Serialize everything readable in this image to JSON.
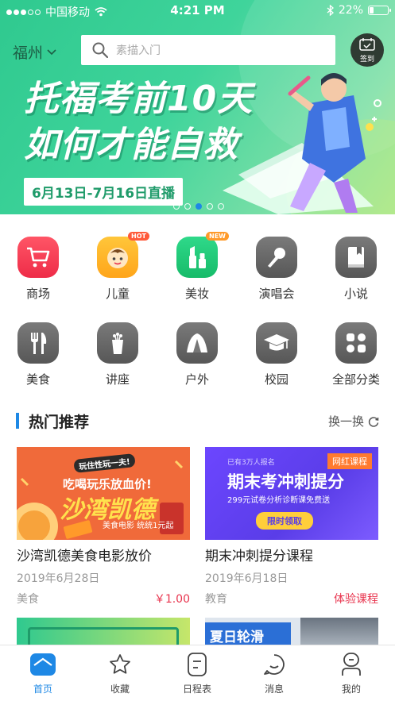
{
  "status_bar": {
    "carrier": "中国移动",
    "time": "4:21 PM",
    "battery": "22%",
    "battery_level": 0.22
  },
  "header": {
    "city": "福州",
    "search_placeholder": "素描入门",
    "checkin_label": "签到"
  },
  "banner": {
    "line1": "托福考前10天",
    "line2": "如何才能自救",
    "date_range": "6月13日-7月16日直播",
    "page_count": 5,
    "active_index": 2,
    "colors": {
      "bg_start": "#2fc98f",
      "bg_end": "#b3e88e"
    }
  },
  "categories": [
    {
      "label": "商场",
      "icon": "shopping-cart-icon",
      "color": "#f23a52"
    },
    {
      "label": "儿童",
      "icon": "child-face-icon",
      "color": "#ffb41f",
      "badge": "HOT"
    },
    {
      "label": "美妆",
      "icon": "lipstick-icon",
      "color": "#22c977",
      "badge": "NEW"
    },
    {
      "label": "演唱会",
      "icon": "microphone-icon",
      "color": "#666666"
    },
    {
      "label": "小说",
      "icon": "book-icon",
      "color": "#666666"
    },
    {
      "label": "美食",
      "icon": "fork-knife-icon",
      "color": "#666666"
    },
    {
      "label": "讲座",
      "icon": "lecture-icon",
      "color": "#666666"
    },
    {
      "label": "户外",
      "icon": "tent-icon",
      "color": "#666666"
    },
    {
      "label": "校园",
      "icon": "graduation-cap-icon",
      "color": "#666666"
    },
    {
      "label": "全部分类",
      "icon": "all-categories-icon",
      "color": "#666666"
    }
  ],
  "section": {
    "title": "热门推荐",
    "refresh_label": "换一换"
  },
  "cards": [
    {
      "title": "沙湾凯德美食电影放价",
      "date": "2019年6月28日",
      "category": "美食",
      "price": "￥1.00",
      "image_text": {
        "tag": "玩住性玩一夫!",
        "line1": "吃喝玩乐放血价!",
        "line2": "沙湾凯德",
        "line3": "美食电影 统统1元起"
      }
    },
    {
      "title": "期末冲刺提分课程",
      "date": "2019年6月18日",
      "category": "教育",
      "price": "体验课程",
      "image_text": {
        "enrolled": "已有3万人报名",
        "tag": "网红课程",
        "headline": "期末考冲刺提分",
        "sub": "299元试卷分析诊断课免费送",
        "button": "限时领取"
      }
    }
  ],
  "peek_cards": [
    {
      "text": ""
    },
    {
      "text": "夏日轮滑"
    }
  ],
  "tabs": [
    {
      "label": "首页",
      "icon": "home-icon",
      "active": true
    },
    {
      "label": "收藏",
      "icon": "star-icon",
      "active": false
    },
    {
      "label": "日程表",
      "icon": "schedule-icon",
      "active": false
    },
    {
      "label": "消息",
      "icon": "message-icon",
      "active": false
    },
    {
      "label": "我的",
      "icon": "profile-icon",
      "active": false
    }
  ],
  "colors": {
    "accent": "#1e88e5",
    "price": "#e8344e"
  }
}
